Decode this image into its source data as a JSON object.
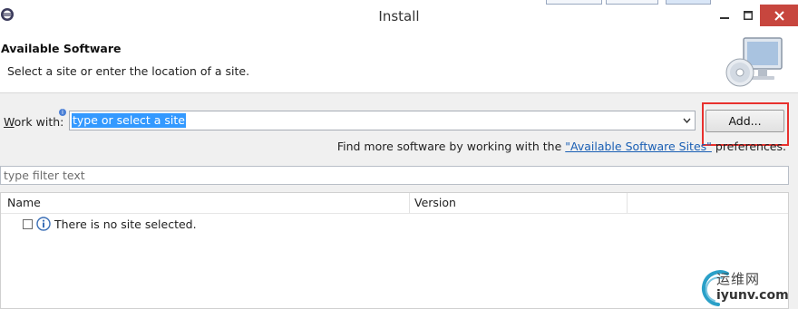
{
  "window": {
    "title": "Install"
  },
  "header": {
    "title": "Available Software",
    "description": "Select a site or enter the location of a site."
  },
  "work_with": {
    "label_prefix": "W",
    "label_rest": "ork with:",
    "value": "type or select a site",
    "info_glyph": "i"
  },
  "buttons": {
    "add_label": "Add..."
  },
  "find_more": {
    "prefix": "Find more software by working with the ",
    "link": "\"Available Software Sites\"",
    "suffix": " preferences."
  },
  "filter": {
    "placeholder": "type filter text"
  },
  "table": {
    "columns": [
      "Name",
      "Version"
    ],
    "rows": [
      {
        "text": "There is no site selected.",
        "checked": false
      }
    ]
  },
  "watermark": {
    "cn": "运维网",
    "en": "iyunv.com"
  },
  "colors": {
    "selection": "#3399ff",
    "link": "#1a5fb4",
    "highlight_box": "#e8312e",
    "close_button": "#c7463e"
  }
}
